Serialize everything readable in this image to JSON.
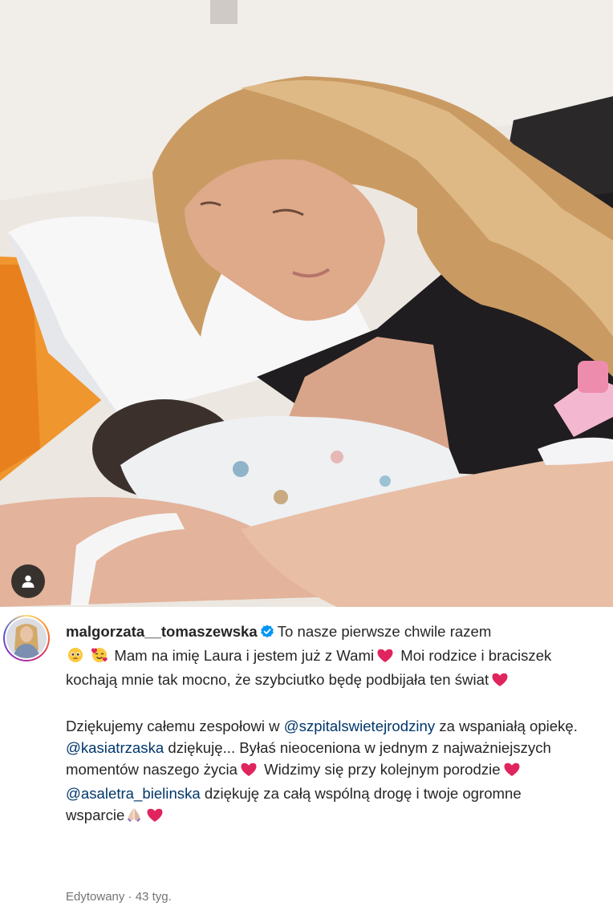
{
  "post": {
    "username": "malgorzata__tomaszewska",
    "caption": {
      "line1_a": "To nasze pierwsze chwile razem",
      "line1_b": "Mam na imię Laura i jestem już z Wami",
      "line1_c": "Moi rodzice i braciszek kochają mnie tak mocno, że szybciutko będę podbijała ten świat",
      "p2_a": "Dziękujemy całemu zespołowi w",
      "mention1": "@szpitalswietejrodziny",
      "p2_b": "za wspaniałą opiekę.",
      "mention2": "@kasiatrzaska",
      "p3_a": "dziękuję... Byłaś nieoceniona w jednym z najważniejszych momentów naszego życia",
      "p3_b": "Widzimy się przy kolejnym porodzie",
      "mention3": "@asaletra_bielinska",
      "p4_a": "dziękuję za całą wspólną drogę i twoje ogromne wsparcie"
    },
    "meta": {
      "edited": "Edytowany",
      "separator": "·",
      "age": "43 tyg."
    }
  },
  "icons": {
    "user_tag": "user-tag-icon",
    "verified": "verified-badge-icon",
    "heart": "red-heart-icon",
    "emoji_pleading": "pleading-face-icon",
    "emoji_hearts": "smiling-face-with-hearts-icon",
    "emoji_pray": "folded-hands-icon"
  },
  "colors": {
    "verified": "#0095f6",
    "mention": "#00376b",
    "heart": "#e0245e",
    "meta": "#737373"
  }
}
